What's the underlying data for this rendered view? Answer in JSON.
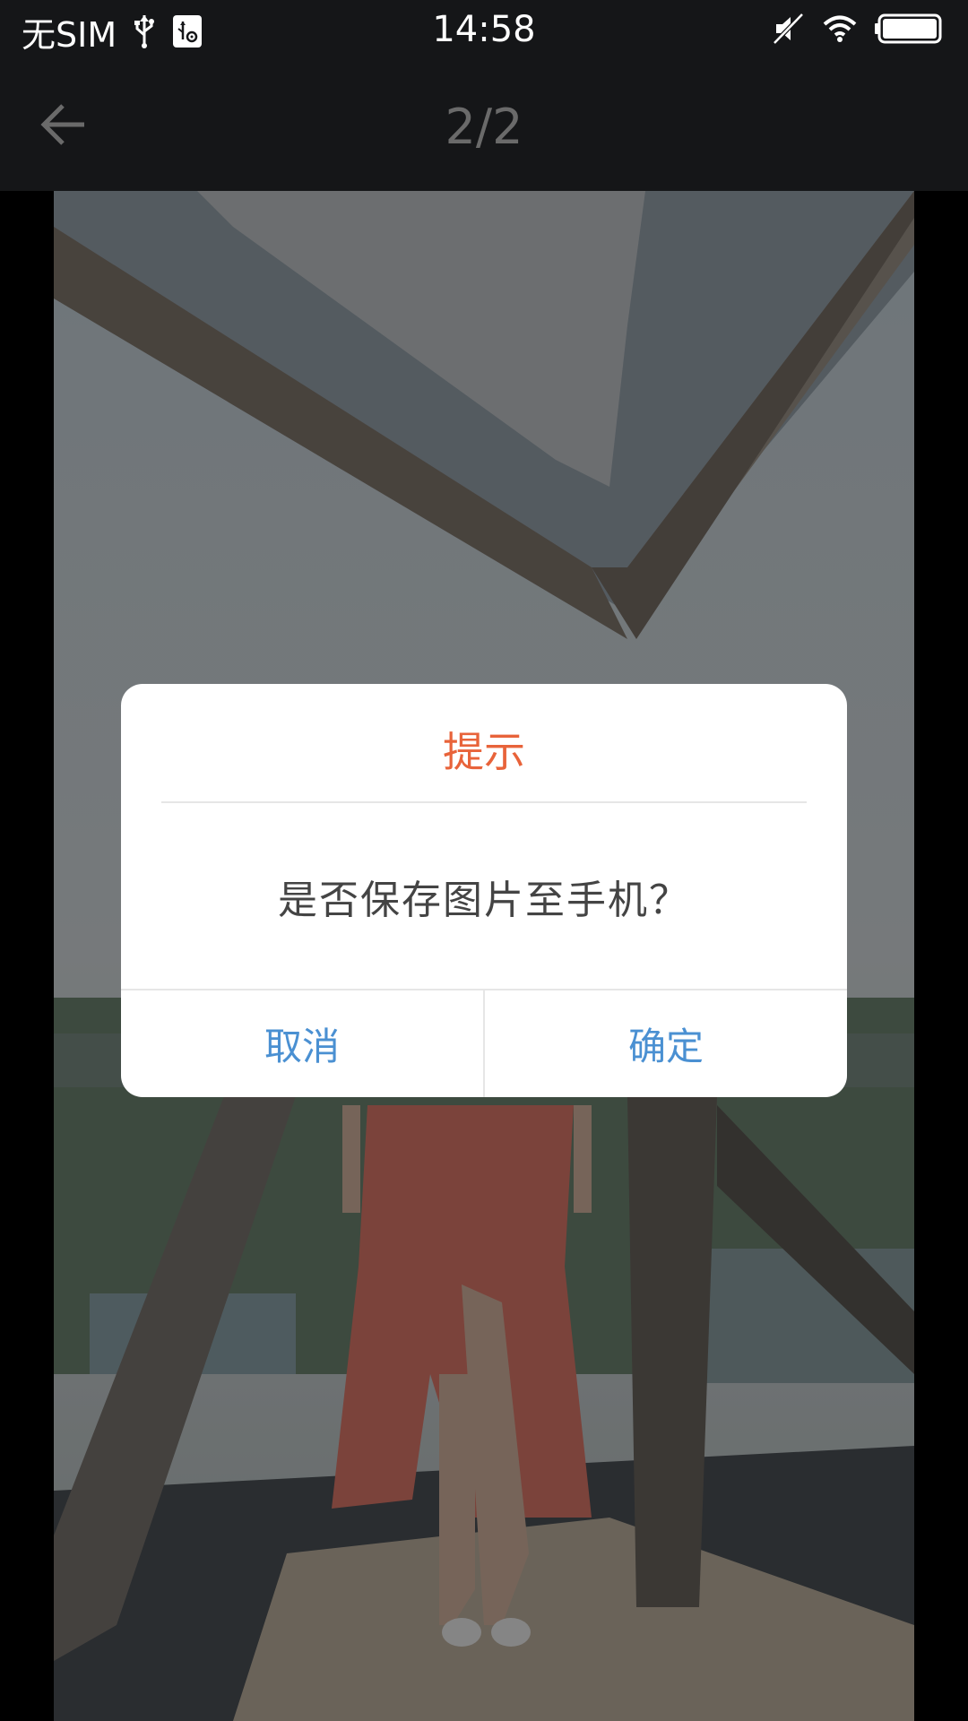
{
  "status_bar": {
    "carrier": "无SIM",
    "time": "14:58",
    "icons": [
      "usb-icon",
      "usb-debug-icon",
      "mute-icon",
      "wifi-icon",
      "battery-icon"
    ]
  },
  "title_bar": {
    "back_icon": "arrow-left-icon",
    "page_counter": "2/2"
  },
  "dialog": {
    "title": "提示",
    "message": "是否保存图片至手机？",
    "cancel_label": "取消",
    "confirm_label": "确定",
    "title_color": "#e8633a",
    "button_color": "#4a90d2"
  }
}
